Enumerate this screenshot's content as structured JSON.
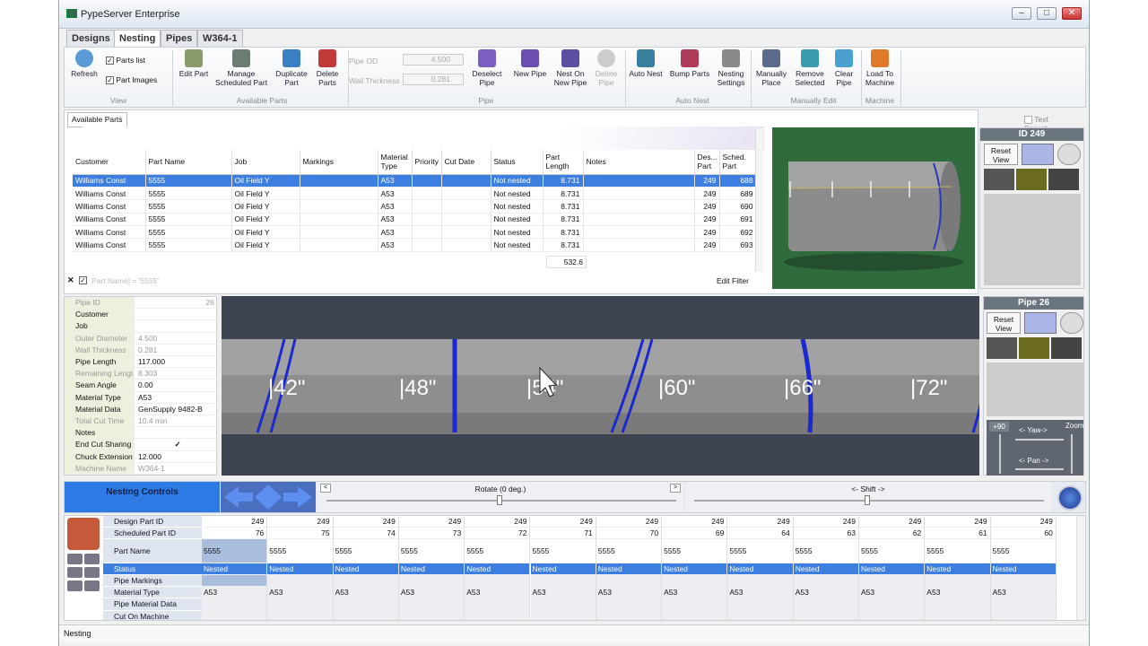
{
  "window": {
    "title": "PypeServer Enterprise"
  },
  "tabs": [
    {
      "label": "Designs"
    },
    {
      "label": "Nesting"
    },
    {
      "label": "Pipes"
    },
    {
      "label": "W364-1"
    }
  ],
  "ribbon": {
    "view": {
      "group": "View",
      "refresh": "Refresh",
      "parts_list": "Parts list",
      "part_images": "Part Images"
    },
    "available_parts": {
      "group": "Available Parts",
      "edit_part": "Edit Part",
      "manage_scheduled": "Manage Scheduled Part",
      "duplicate_part": "Duplicate Part",
      "delete_parts": "Delete Parts"
    },
    "pipe": {
      "group": "Pipe",
      "pipe_od_label": "Pipe OD",
      "pipe_od_value": "4.500",
      "wall_thickness_label": "Wall Thickness",
      "wall_thickness_value": "0.281",
      "deselect_pipe": "Deselect Pipe",
      "new_pipe": "New Pipe",
      "nest_on_new_pipe": "Nest On New Pipe",
      "delete_pipe": "Delete Pipe"
    },
    "auto_nest": {
      "group": "Auto Nest",
      "auto_nest": "Auto Nest",
      "bump_parts": "Bump Parts",
      "nesting_settings": "Nesting Settings"
    },
    "manually_edit": {
      "group": "Manually Edit",
      "manually_place": "Manually Place",
      "remove_selected": "Remove Selected",
      "clear_pipe": "Clear Pipe"
    },
    "machine": {
      "group": "Machine",
      "load_to_machine": "Load To Machine"
    }
  },
  "parts_panel": {
    "tab": "Available Parts",
    "text_search": "Text Search",
    "filter_text": "Part Name] = '5555'",
    "edit_filter": "Edit Filter",
    "total_length": "532.6",
    "columns": [
      "Customer",
      "Part Name",
      "Job",
      "Markings",
      "Material Type",
      "Priority",
      "Cut Date",
      "Status",
      "Part Length",
      "Notes",
      "Des... Part",
      "Sched. Part"
    ],
    "rows": [
      {
        "customer": "Williams Const",
        "part_name": "5555",
        "job": "Oil Field Y",
        "markings": "",
        "material": "A53",
        "priority": "",
        "cut_date": "",
        "status": "Not nested",
        "length": "8.731",
        "notes": "",
        "design_part": "249",
        "sched_part": "688"
      },
      {
        "customer": "Williams Const",
        "part_name": "5555",
        "job": "Oil Field Y",
        "markings": "",
        "material": "A53",
        "priority": "",
        "cut_date": "",
        "status": "Not nested",
        "length": "8.731",
        "notes": "",
        "design_part": "249",
        "sched_part": "689"
      },
      {
        "customer": "Williams Const",
        "part_name": "5555",
        "job": "Oil Field Y",
        "markings": "",
        "material": "A53",
        "priority": "",
        "cut_date": "",
        "status": "Not nested",
        "length": "8.731",
        "notes": "",
        "design_part": "249",
        "sched_part": "690"
      },
      {
        "customer": "Williams Const",
        "part_name": "5555",
        "job": "Oil Field Y",
        "markings": "",
        "material": "A53",
        "priority": "",
        "cut_date": "",
        "status": "Not nested",
        "length": "8.731",
        "notes": "",
        "design_part": "249",
        "sched_part": "691"
      },
      {
        "customer": "Williams Const",
        "part_name": "5555",
        "job": "Oil Field Y",
        "markings": "",
        "material": "A53",
        "priority": "",
        "cut_date": "",
        "status": "Not nested",
        "length": "8.731",
        "notes": "",
        "design_part": "249",
        "sched_part": "692"
      },
      {
        "customer": "Williams Const",
        "part_name": "5555",
        "job": "Oil Field Y",
        "markings": "",
        "material": "A53",
        "priority": "",
        "cut_date": "",
        "status": "Not nested",
        "length": "8.731",
        "notes": "",
        "design_part": "249",
        "sched_part": "693"
      }
    ]
  },
  "part_view": {
    "title": "ID 249",
    "reset_view": "Reset View"
  },
  "pipe_panel": {
    "title": "Pipe 26",
    "reset_view": "Reset View",
    "yaw": "<- Yaw->",
    "pan": "<- Pan ->",
    "zoom": "Zoom",
    "plus90": "+90"
  },
  "pipe_props": [
    {
      "label": "Pipe ID",
      "value": "26",
      "dim": true
    },
    {
      "label": "Customer",
      "value": ""
    },
    {
      "label": "Job",
      "value": ""
    },
    {
      "label": "Outer Diameter",
      "value": "4.500",
      "dim": true
    },
    {
      "label": "Wall Thickness",
      "value": "0.281",
      "dim": true
    },
    {
      "label": "Pipe Length",
      "value": "117.000"
    },
    {
      "label": "Remaining Lengt",
      "value": "8.303",
      "dim": true
    },
    {
      "label": "Seam Angle",
      "value": "0.00"
    },
    {
      "label": "Material Type",
      "value": "A53"
    },
    {
      "label": "Material Data",
      "value": "GenSupply 9482-B"
    },
    {
      "label": "Total Cut Time",
      "value": "10.4 min",
      "dim": true
    },
    {
      "label": "Notes",
      "value": ""
    },
    {
      "label": "End Cut Sharing",
      "value": "✓"
    },
    {
      "label": "Chuck Extension",
      "value": "12.000"
    },
    {
      "label": "Machine Name",
      "value": "W364-1",
      "dim": true
    }
  ],
  "pipe_marks": [
    "|42\"",
    "|48\"",
    "|54\"",
    "|60\"",
    "|66\"",
    "|72\""
  ],
  "nesting_controls": {
    "label": "Nesting Controls",
    "rotate": "Rotate (0 deg.)",
    "shift": "<- Shift ->"
  },
  "nested_grid": {
    "row_labels": [
      "Design Part ID",
      "Scheduled Part ID",
      "Part Name",
      "Status",
      "Pipe Markings",
      "Material Type",
      "Pipe Material Data",
      "Cut On Machine"
    ],
    "columns": [
      {
        "design": "249",
        "sched": "76",
        "name": "5555",
        "status": "Nested",
        "material": "A53"
      },
      {
        "design": "249",
        "sched": "75",
        "name": "5555",
        "status": "Nested",
        "material": "A53"
      },
      {
        "design": "249",
        "sched": "74",
        "name": "5555",
        "status": "Nested",
        "material": "A53"
      },
      {
        "design": "249",
        "sched": "73",
        "name": "5555",
        "status": "Nested",
        "material": "A53"
      },
      {
        "design": "249",
        "sched": "72",
        "name": "5555",
        "status": "Nested",
        "material": "A53"
      },
      {
        "design": "249",
        "sched": "71",
        "name": "5555",
        "status": "Nested",
        "material": "A53"
      },
      {
        "design": "249",
        "sched": "70",
        "name": "5555",
        "status": "Nested",
        "material": "A53"
      },
      {
        "design": "249",
        "sched": "69",
        "name": "5555",
        "status": "Nested",
        "material": "A53"
      },
      {
        "design": "249",
        "sched": "64",
        "name": "5555",
        "status": "Nested",
        "material": "A53"
      },
      {
        "design": "249",
        "sched": "63",
        "name": "5555",
        "status": "Nested",
        "material": "A53"
      },
      {
        "design": "249",
        "sched": "62",
        "name": "5555",
        "status": "Nested",
        "material": "A53"
      },
      {
        "design": "249",
        "sched": "61",
        "name": "5555",
        "status": "Nested",
        "material": "A53"
      },
      {
        "design": "249",
        "sched": "60",
        "name": "5555",
        "status": "Nested",
        "material": "A53"
      }
    ]
  },
  "statusbar": {
    "text": "Nesting"
  }
}
